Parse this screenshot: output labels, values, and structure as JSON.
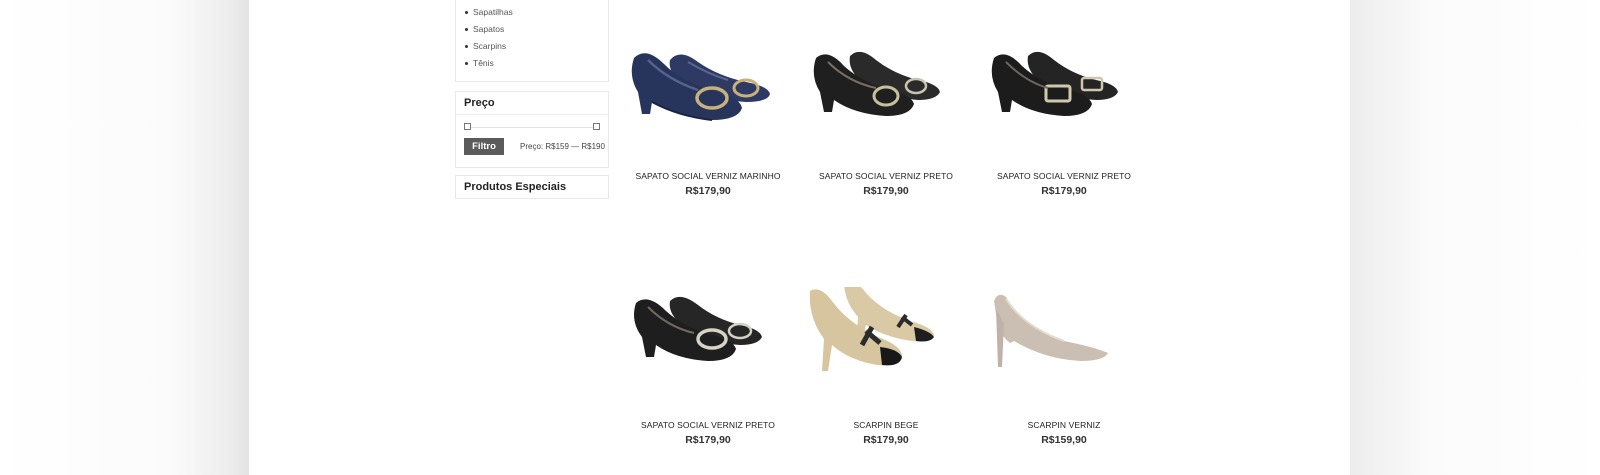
{
  "categories": {
    "items": [
      "Sapatilhas",
      "Sapatos",
      "Scarpins",
      "Tênis"
    ]
  },
  "price_filter": {
    "title": "Preço",
    "button_label": "Filtro",
    "price_label": "Preço: R$159 — R$190"
  },
  "special_products": {
    "title": "Produtos Especiais"
  },
  "products": [
    {
      "name": "SAPATO SOCIAL VERNIZ MARINHO",
      "price": "R$179,90"
    },
    {
      "name": "SAPATO SOCIAL VERNIZ PRETO",
      "price": "R$179,90"
    },
    {
      "name": "SAPATO SOCIAL VERNIZ PRETO",
      "price": "R$179,90"
    },
    {
      "name": "SAPATO SOCIAL VERNIZ PRETO",
      "price": "R$179,90"
    },
    {
      "name": "SCARPIN BEGE",
      "price": "R$179,90"
    },
    {
      "name": "SCARPIN VERNIZ",
      "price": "R$159,90"
    }
  ],
  "colors": {
    "navy_shoe": "#27345c",
    "black_shoe": "#1f1f1f",
    "beige_shoe": "#d7c7a2",
    "nude_shoe": "#cfc3b8",
    "filter_button": "#5b5b5b"
  }
}
